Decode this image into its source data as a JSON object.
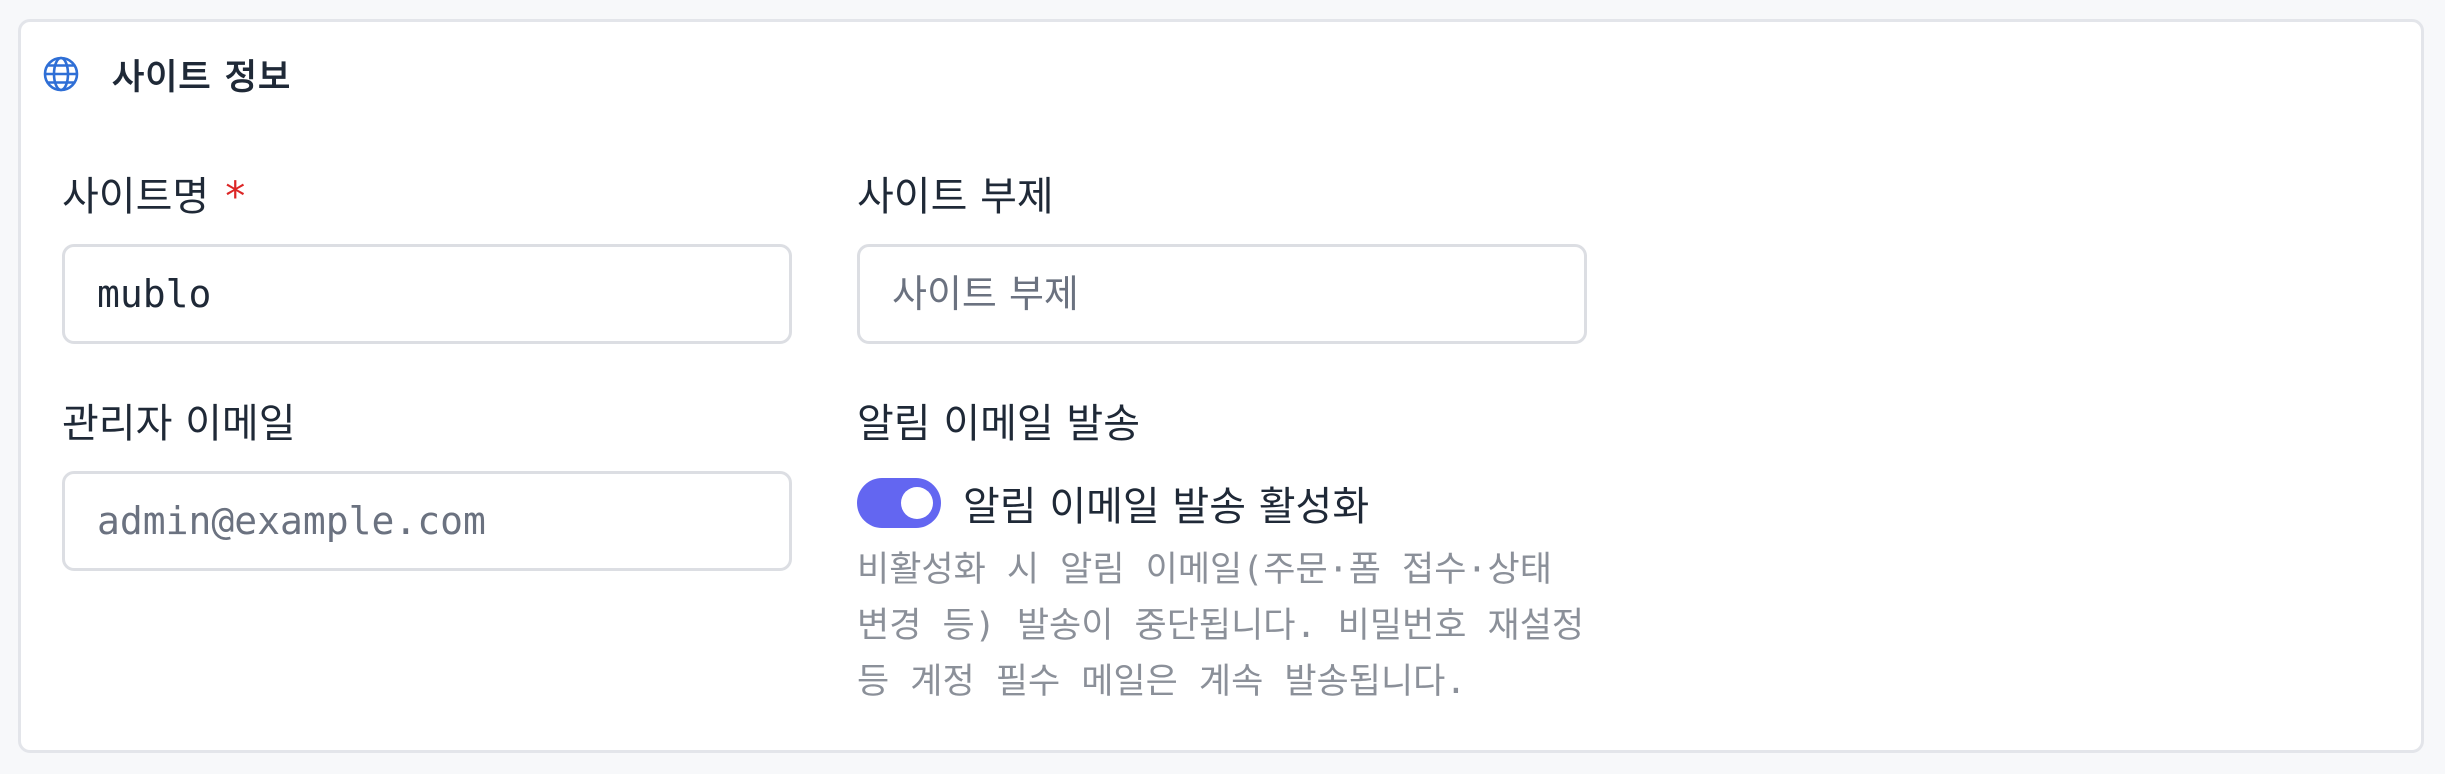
{
  "section": {
    "title": "사이트 정보",
    "icon": "globe-icon",
    "accent_color": "#2f6fd6"
  },
  "fields": {
    "site_name": {
      "label": "사이트명",
      "required_mark": "*",
      "value": "mublo"
    },
    "site_subtitle": {
      "label": "사이트 부제",
      "value": "",
      "placeholder": "사이트 부제"
    },
    "admin_email": {
      "label": "관리자 이메일",
      "value": "",
      "placeholder": "admin@example.com"
    },
    "notification_email": {
      "label": "알림 이메일 발송",
      "toggle_label": "알림 이메일 발송 활성화",
      "enabled": true,
      "toggle_color": "#6366f1",
      "help_text": "비활성화 시 알림 이메일(주문·폼 접수·상태 변경 등) 발송이 중단됩니다. 비밀번호 재설정 등 계정 필수 메일은 계속 발송됩니다."
    }
  }
}
